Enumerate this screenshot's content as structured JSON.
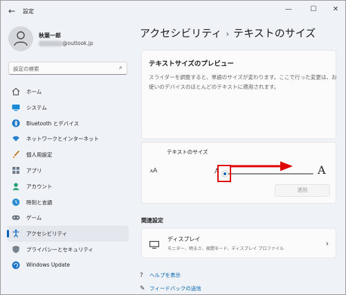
{
  "window": {
    "title": "設定"
  },
  "profile": {
    "name": "秋葉一郎",
    "email_suffix": "@outlook.jp"
  },
  "search": {
    "placeholder": "設定の検索"
  },
  "nav": {
    "items": [
      {
        "label": "ホーム",
        "icon": "home-icon"
      },
      {
        "label": "システム",
        "icon": "system-icon"
      },
      {
        "label": "Bluetooth とデバイス",
        "icon": "bluetooth-icon"
      },
      {
        "label": "ネットワークとインターネット",
        "icon": "network-icon"
      },
      {
        "label": "個人用設定",
        "icon": "brush-icon"
      },
      {
        "label": "アプリ",
        "icon": "apps-icon"
      },
      {
        "label": "アカウント",
        "icon": "account-icon"
      },
      {
        "label": "時刻と言語",
        "icon": "time-language-icon"
      },
      {
        "label": "ゲーム",
        "icon": "gaming-icon"
      },
      {
        "label": "アクセシビリティ",
        "icon": "accessibility-icon",
        "active": true
      },
      {
        "label": "プライバシーとセキュリティ",
        "icon": "shield-icon"
      },
      {
        "label": "Windows Update",
        "icon": "update-icon"
      }
    ]
  },
  "breadcrumb": {
    "parent": "アクセシビリティ",
    "separator": "›",
    "current": "テキストのサイズ"
  },
  "preview": {
    "title": "テキストサイズのプレビュー",
    "body": "スライダーを調整すると、単語のサイズが変わります。ここで行った変更は、お使いのデバイスのほとんどのテキストに適用されます。"
  },
  "text_size": {
    "label": "テキストのサイズ",
    "small_glyph": "A",
    "large_glyph": "A",
    "slider_value": 0.0,
    "apply_label": "適用"
  },
  "related": {
    "heading": "関連設定",
    "display_title": "ディスプレイ",
    "display_subtitle": "モニター、明るさ、夜間モード、ディスプレイ プロファイル"
  },
  "links": {
    "help": "ヘルプを表示",
    "feedback": "フィードバックの送信"
  },
  "colors": {
    "accent": "#005fb8",
    "annotation": "#e00000"
  }
}
